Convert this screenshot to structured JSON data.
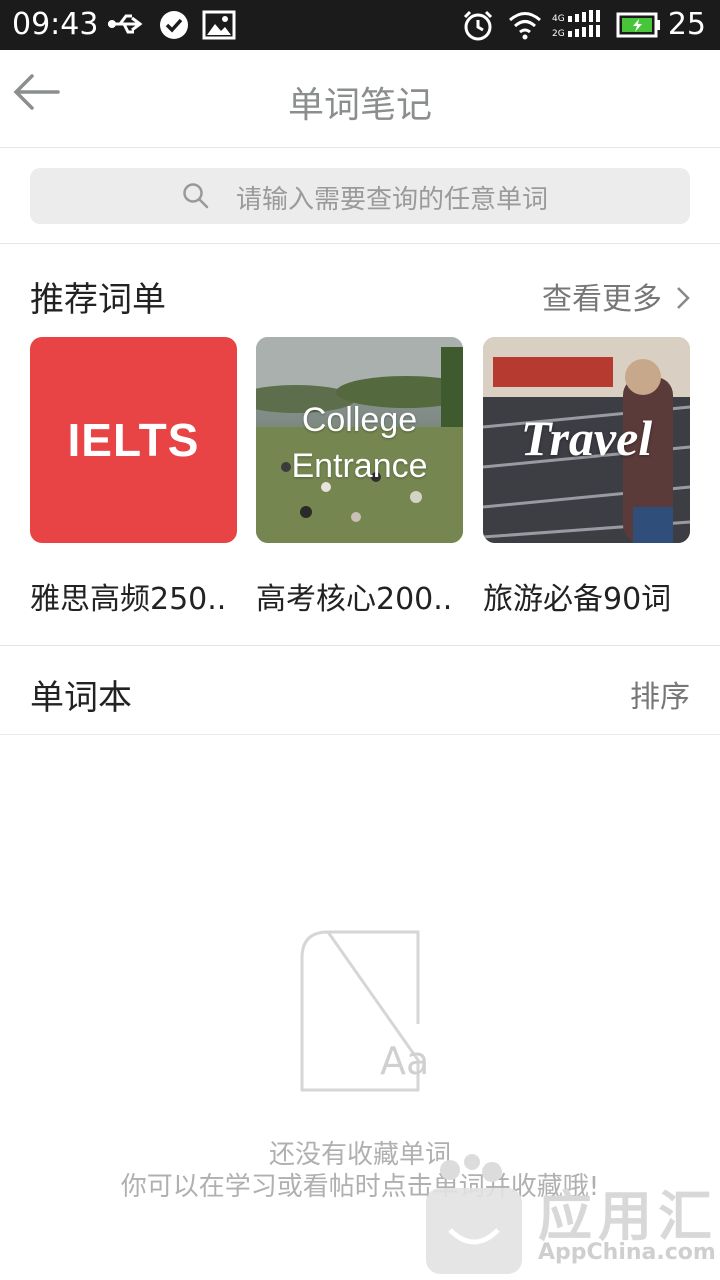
{
  "status_bar": {
    "time": "09:43",
    "battery_level": "25",
    "icons": [
      "usb-icon",
      "check-circle-icon",
      "image-icon",
      "alarm-icon",
      "wifi-icon",
      "signal-icon",
      "battery-icon"
    ]
  },
  "nav": {
    "title": "单词笔记",
    "back_icon": "back-arrow-icon"
  },
  "search": {
    "placeholder": "请输入需要查询的任意单词"
  },
  "recommend": {
    "title": "推荐词单",
    "more_label": "查看更多",
    "cards": [
      {
        "image_text": "IELTS",
        "label": "雅思高频250..",
        "color": "#e84446"
      },
      {
        "image_text_line1": "College",
        "image_text_line2": "Entrance",
        "label": "高考核心200.."
      },
      {
        "image_text": "Travel",
        "label": "旅游必备90词"
      }
    ]
  },
  "wordbook": {
    "title": "单词本",
    "sort_label": "排序",
    "empty_icon_text": "Aa",
    "empty_line1": "还没有收藏单词",
    "empty_line2": "你可以在学习或看帖时点击单词并收藏哦!"
  },
  "watermark": {
    "text": "应用汇",
    "sub": "AppChina.com"
  },
  "colors": {
    "accent_red": "#e84446",
    "status_bar": "#1b1b1b",
    "search_bg": "#ececed"
  }
}
